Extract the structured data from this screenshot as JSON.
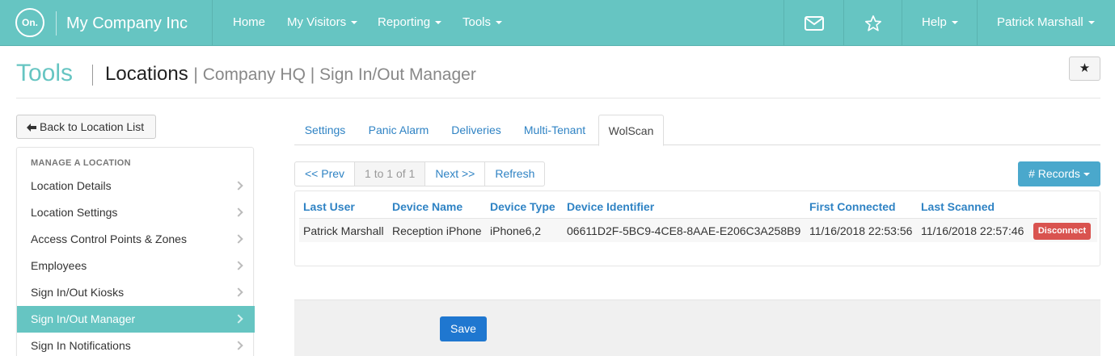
{
  "navbar": {
    "logo_text": "On.",
    "brand": "My Company Inc",
    "items": [
      {
        "label": "Home"
      },
      {
        "label": "My Visitors"
      },
      {
        "label": "Reporting"
      },
      {
        "label": "Tools"
      }
    ],
    "mail_icon": "mail-icon",
    "star_icon": "star-icon",
    "help": "Help",
    "user": "Patrick Marshall"
  },
  "header": {
    "section": "Tools",
    "title": "Locations",
    "subtitle": "| Company HQ | Sign In/Out Manager",
    "star_glyph": "★"
  },
  "sidebar": {
    "back_label": "Back to Location List",
    "heading": "MANAGE A LOCATION",
    "items": [
      {
        "label": "Location Details"
      },
      {
        "label": "Location Settings"
      },
      {
        "label": "Access Control Points & Zones"
      },
      {
        "label": "Employees"
      },
      {
        "label": "Sign In/Out Kiosks"
      },
      {
        "label": "Sign In/Out Manager"
      },
      {
        "label": "Sign In Notifications"
      }
    ],
    "active_index": 5
  },
  "tabs": [
    {
      "label": "Settings"
    },
    {
      "label": "Panic Alarm"
    },
    {
      "label": "Deliveries"
    },
    {
      "label": "Multi-Tenant"
    },
    {
      "label": "WolScan"
    }
  ],
  "pager": {
    "prev": "<< Prev",
    "info": "1 to 1 of 1",
    "next": "Next >>",
    "refresh": "Refresh"
  },
  "records_label": "# Records",
  "table": {
    "columns": [
      "Last User",
      "Device Name",
      "Device Type",
      "Device Identifier",
      "First Connected",
      "Last Scanned"
    ],
    "rows": [
      {
        "cells": [
          "Patrick Marshall",
          "Reception iPhone",
          "iPhone6,2",
          "06611D2F-5BC9-4CE8-8AAE-E206C3A258B9",
          "11/16/2018 22:53:56",
          "11/16/2018 22:57:46"
        ],
        "action": "Disconnect"
      }
    ]
  },
  "save_label": "Save",
  "colors": {
    "brand": "#66c5c2",
    "link": "#2f83c4",
    "danger": "#d9534f",
    "primary": "#1f77d0"
  }
}
